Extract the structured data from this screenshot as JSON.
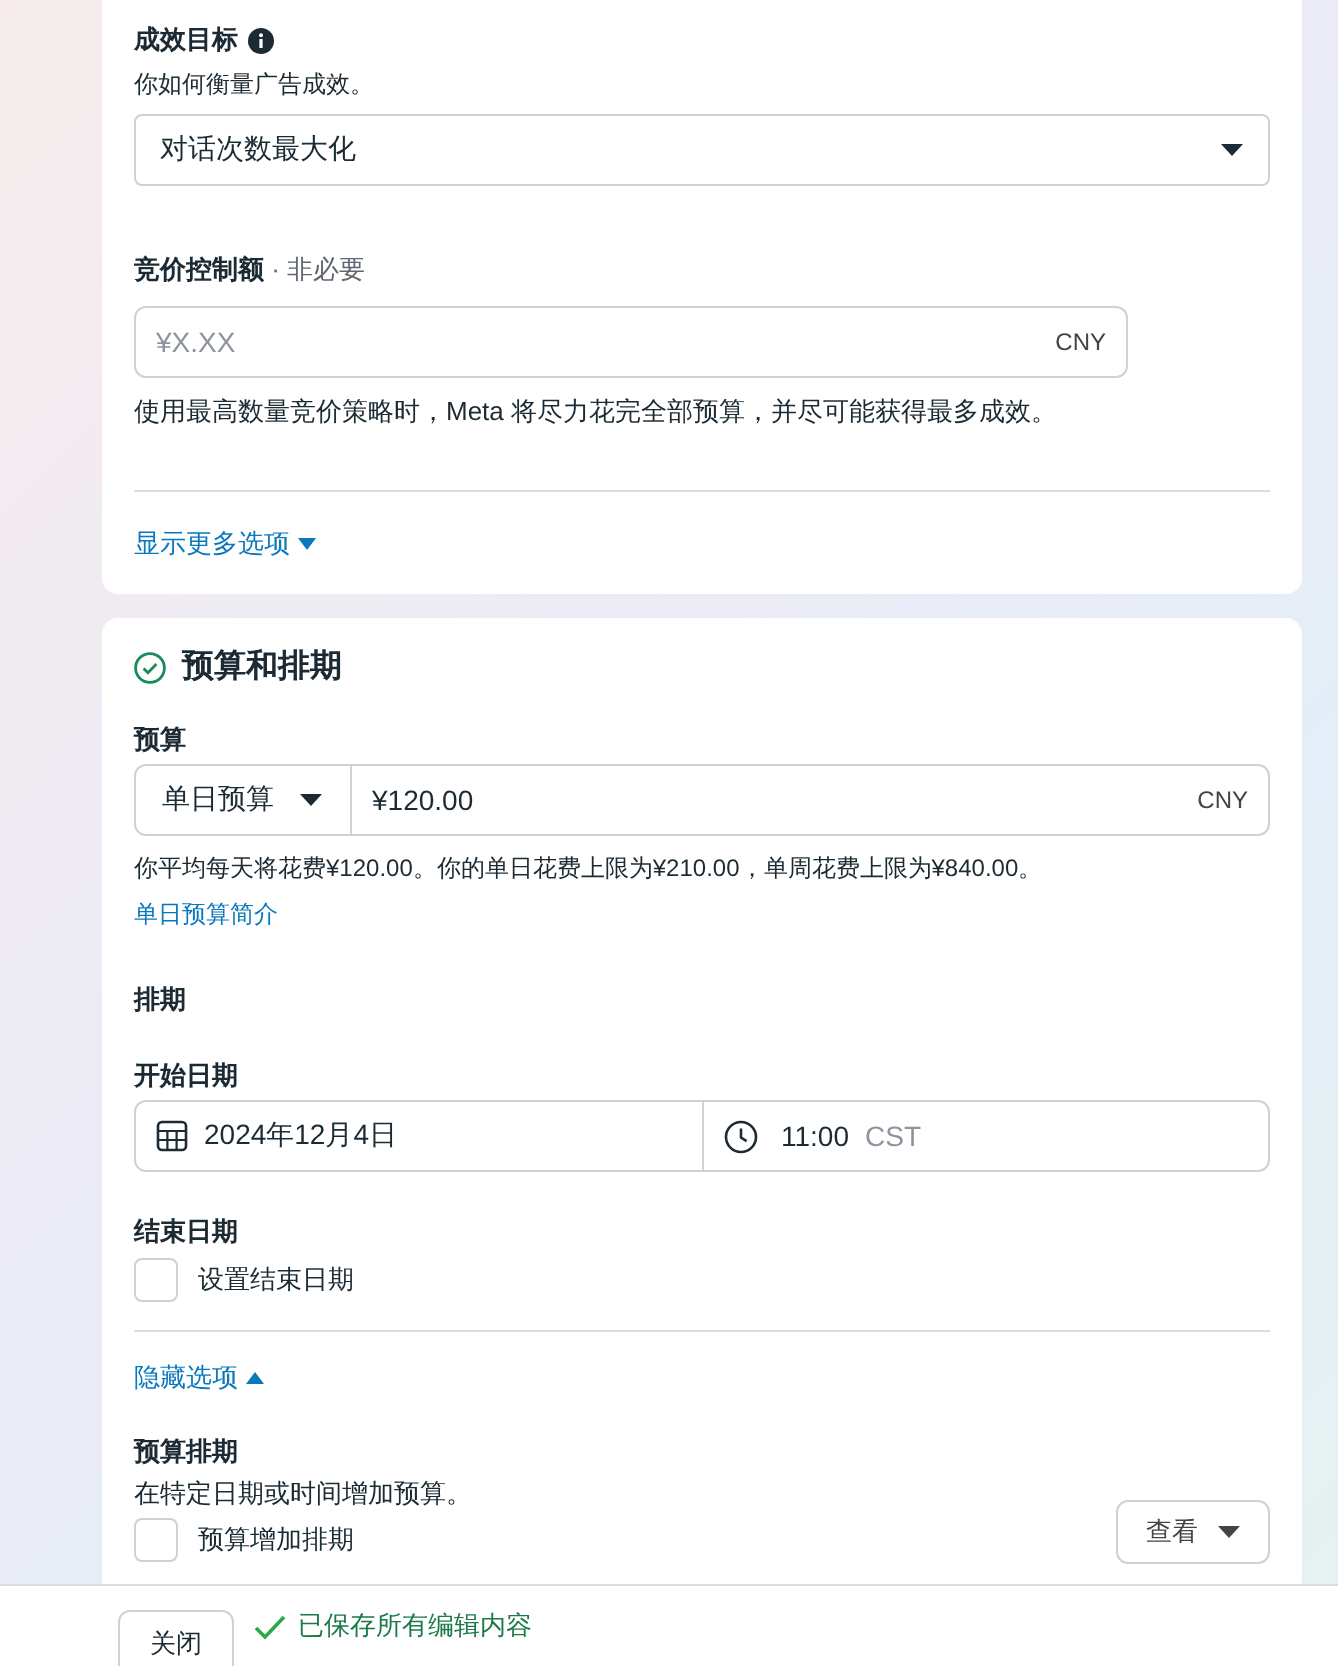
{
  "performance_goal": {
    "title": "成效目标",
    "subtitle": "你如何衡量广告成效。",
    "select_value": "对话次数最大化"
  },
  "bid_control": {
    "label": "竞价控制额",
    "optional": "· 非必要",
    "placeholder": "¥X.XX",
    "currency": "CNY",
    "help": "使用最高数量竞价策略时，Meta 将尽力花完全部预算，并尽可能获得最多成效。"
  },
  "more_options_link": "显示更多选项",
  "budget_schedule": {
    "title": "预算和排期",
    "complete": true,
    "budget_label": "预算",
    "budget_type": "单日预算",
    "budget_value": "¥120.00",
    "budget_currency": "CNY",
    "budget_help": "你平均每天将花费¥120.00。你的单日花费上限为¥210.00，单周花费上限为¥840.00。",
    "budget_link": "单日预算简介",
    "schedule_label": "排期",
    "start_label": "开始日期",
    "start_date": "2024年12月4日",
    "start_time": "11:00",
    "timezone": "CST",
    "end_label": "结束日期",
    "end_checkbox": {
      "label": "设置结束日期",
      "checked": false
    },
    "hide_options_link": "隐藏选项",
    "budget_scheduling_title": "预算排期",
    "budget_scheduling_help": "在特定日期或时间增加预算。",
    "increase_checkbox": {
      "label": "预算增加排期",
      "checked": false
    },
    "view_button": "查看"
  },
  "footer": {
    "close_button": "关闭",
    "saved_status": "已保存所有编辑内容"
  }
}
